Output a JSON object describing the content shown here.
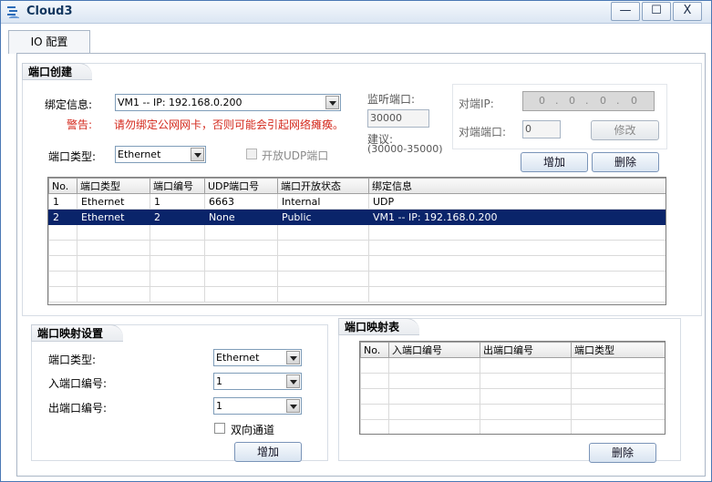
{
  "window": {
    "title": "Cloud3",
    "min_glyph": "—",
    "max_glyph": "☐",
    "close_glyph": "X"
  },
  "tab": {
    "label": "IO 配置"
  },
  "port_create": {
    "title": "端口创建",
    "bind_label": "绑定信息:",
    "bind_value": "VM1 -- IP: 192.168.0.200",
    "warning_label": "警告:",
    "warning_text": "请勿绑定公网网卡，否则可能会引起网络瘫痪。",
    "listen_label": "监听端口:",
    "listen_value": "30000",
    "suggest_label": "建议:",
    "suggest_range": "(30000-35000)",
    "port_type_label": "端口类型:",
    "port_type_value": "Ethernet",
    "open_udp_label": "开放UDP端口",
    "remote_ip_label": "对端IP:",
    "remote_ip_parts": [
      "0",
      "0",
      "0",
      "0"
    ],
    "remote_port_label": "对端端口:",
    "remote_port_value": "0",
    "modify_label": "修改",
    "add_label": "增加",
    "delete_label": "删除",
    "table": {
      "headers": [
        "No.",
        "端口类型",
        "端口编号",
        "UDP端口号",
        "端口开放状态",
        "绑定信息"
      ],
      "rows": [
        [
          "1",
          "Ethernet",
          "1",
          "6663",
          "Internal",
          "UDP"
        ],
        [
          "2",
          "Ethernet",
          "2",
          "None",
          "Public",
          "VM1 -- IP: 192.168.0.200"
        ]
      ]
    }
  },
  "mapping_settings": {
    "title": "端口映射设置",
    "port_type_label": "端口类型:",
    "port_type_value": "Ethernet",
    "in_port_label": "入端口编号:",
    "in_port_value": "1",
    "out_port_label": "出端口编号:",
    "out_port_value": "1",
    "bidirectional_label": "双向通道",
    "add_label": "增加"
  },
  "mapping_table": {
    "title": "端口映射表",
    "headers": [
      "No.",
      "入端口编号",
      "出端口编号",
      "端口类型"
    ],
    "delete_label": "删除"
  }
}
